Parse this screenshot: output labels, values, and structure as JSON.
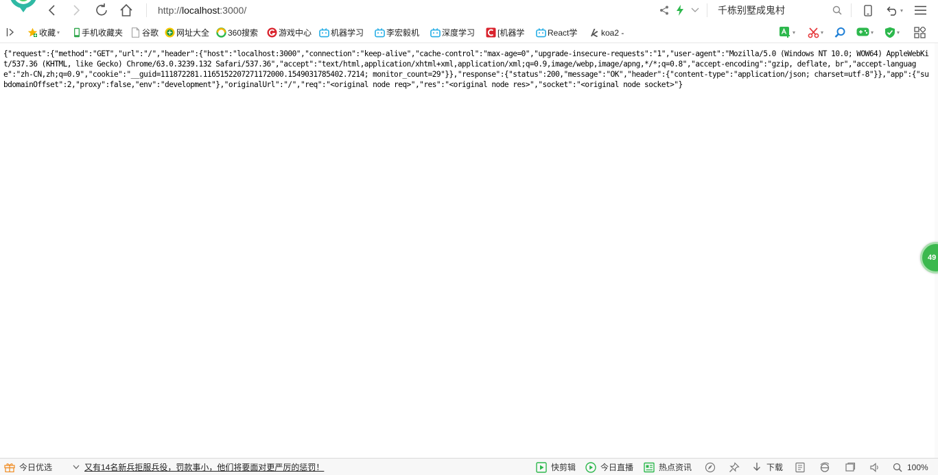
{
  "toolbar": {
    "url_prefix": "http://",
    "url_host": "localhost",
    "url_suffix": ":3000/",
    "search_text": "千栋别墅成鬼村"
  },
  "bookmarks": [
    {
      "label": "收藏",
      "icon": "star-icon"
    },
    {
      "label": "手机收藏夹",
      "icon": "phone-icon"
    },
    {
      "label": "谷歌",
      "icon": "page-icon"
    },
    {
      "label": "网址大全",
      "icon": "green-globe-icon"
    },
    {
      "label": "360搜索",
      "icon": "search-360-icon"
    },
    {
      "label": "游戏中心",
      "icon": "game-center-icon"
    },
    {
      "label": "机器学习",
      "icon": "bilibili-icon"
    },
    {
      "label": "李宏毅机",
      "icon": "bilibili-icon"
    },
    {
      "label": "深度学习",
      "icon": "bilibili-icon"
    },
    {
      "label": "[机器学",
      "icon": "red-c-icon"
    },
    {
      "label": "React学",
      "icon": "bilibili-icon"
    },
    {
      "label": "koa2 -",
      "icon": "koa-icon"
    }
  ],
  "content": {
    "json_text": "{\"request\":{\"method\":\"GET\",\"url\":\"/\",\"header\":{\"host\":\"localhost:3000\",\"connection\":\"keep-alive\",\"cache-control\":\"max-age=0\",\"upgrade-insecure-requests\":\"1\",\"user-agent\":\"Mozilla/5.0 (Windows NT 10.0; WOW64) AppleWebKit/537.36 (KHTML, like Gecko) Chrome/63.0.3239.132 Safari/537.36\",\"accept\":\"text/html,application/xhtml+xml,application/xml;q=0.9,image/webp,image/apng,*/*;q=0.8\",\"accept-encoding\":\"gzip, deflate, br\",\"accept-language\":\"zh-CN,zh;q=0.9\",\"cookie\":\"__guid=111872281.1165152207271172000.1549031785402.7214; monitor_count=29\"}},\"response\":{\"status\":200,\"message\":\"OK\",\"header\":{\"content-type\":\"application/json; charset=utf-8\"}},\"app\":{\"subdomainOffset\":2,\"proxy\":false,\"env\":\"development\"},\"originalUrl\":\"/\",\"req\":\"<original node req>\",\"res\":\"<original node res>\",\"socket\":\"<original node socket>\"}",
    "float_badge": "49"
  },
  "statusbar": {
    "today_picks": "今日优选",
    "news": "又有14名新兵拒服兵役，罚款事小，他们将要面对更严厉的惩罚！",
    "quick_clip": "快剪辑",
    "today_live": "今日直播",
    "hot_news": "热点资讯",
    "download": "下载",
    "zoom": "100%"
  },
  "colors": {
    "accent_green": "#3cb84e",
    "bilibili_blue": "#23ade5",
    "red": "#d9232d"
  }
}
